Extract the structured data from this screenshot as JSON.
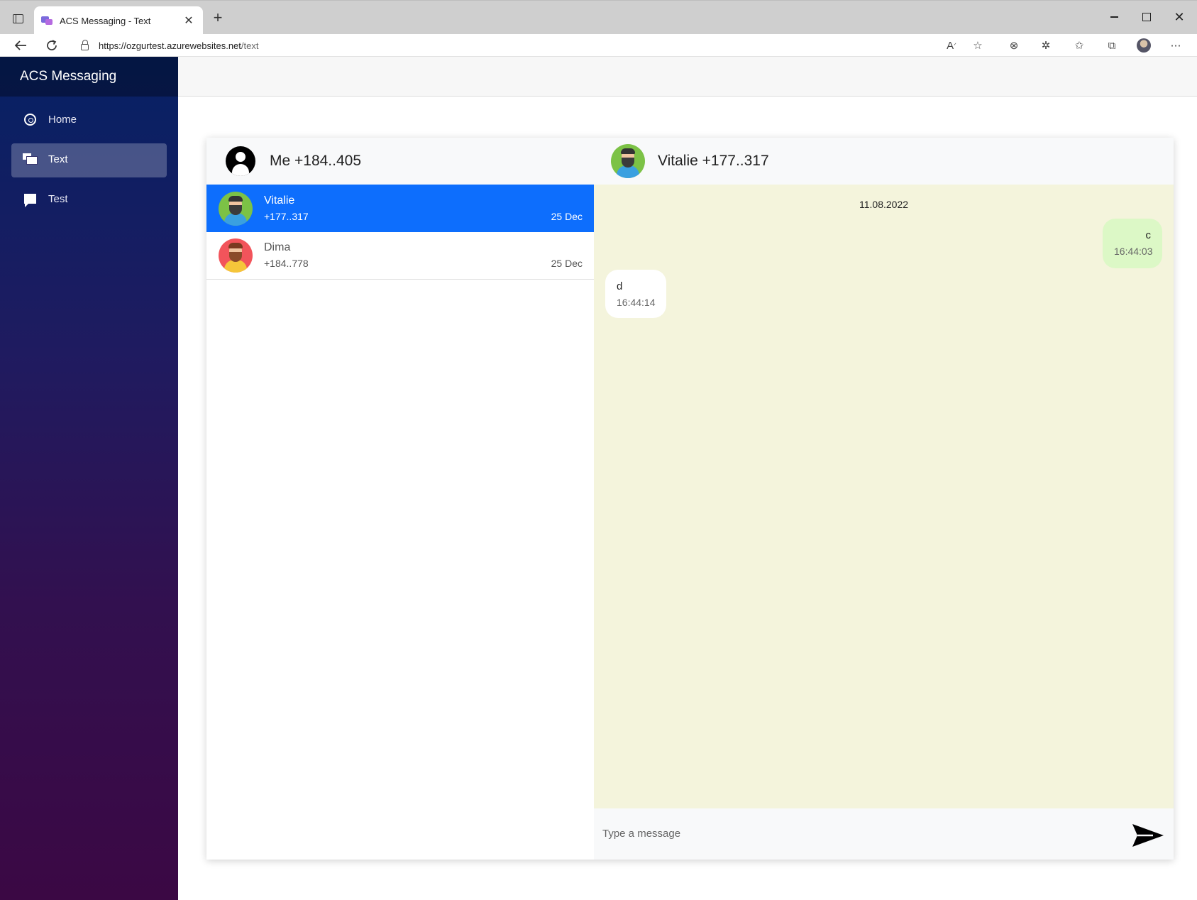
{
  "browser": {
    "tab_title": "ACS Messaging - Text",
    "url_host": "https://ozgurtest.azurewebsites.net",
    "url_path": "/text"
  },
  "app": {
    "brand": "ACS Messaging",
    "nav": [
      {
        "label": "Home",
        "icon": "home-icon"
      },
      {
        "label": "Text",
        "icon": "chats-icon",
        "active": true
      },
      {
        "label": "Test",
        "icon": "chat-icon"
      }
    ]
  },
  "me": {
    "label": "Me +184..405"
  },
  "contacts": [
    {
      "name": "Vitalie",
      "phone": "+177..317",
      "date": "25 Dec",
      "active": true
    },
    {
      "name": "Dima",
      "phone": "+184..778",
      "date": "25 Dec",
      "active": false
    }
  ],
  "conversation": {
    "header": "Vitalie +177..317",
    "date_separator": "11.08.2022",
    "messages": [
      {
        "direction": "out",
        "text": "c",
        "time": "16:44:03"
      },
      {
        "direction": "in",
        "text": "d",
        "time": "16:44:14"
      }
    ],
    "input_placeholder": "Type a message"
  },
  "colors": {
    "accent": "#0d6efd",
    "chat_background": "#f4f4dc",
    "outgoing_bubble": "#dcf8c6",
    "sidebar_top": "#062164",
    "sidebar_bottom": "#3b0844"
  }
}
